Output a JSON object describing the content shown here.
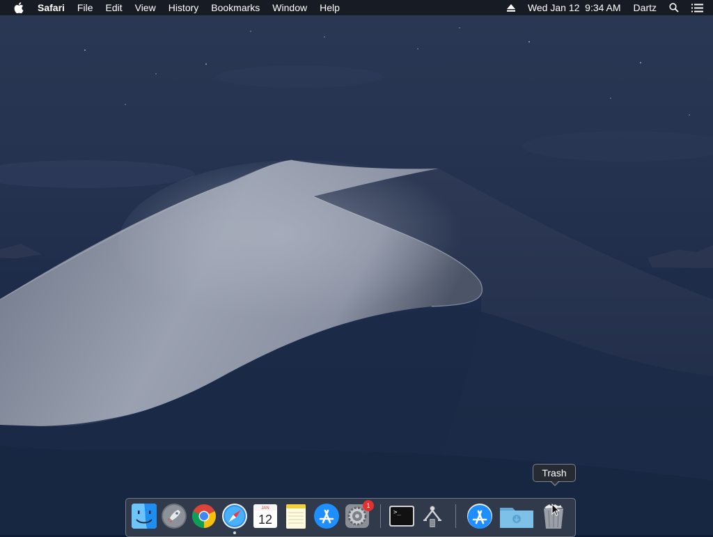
{
  "menubar": {
    "apple_icon": "apple-logo-icon",
    "app_name": "Safari",
    "menus": [
      "File",
      "Edit",
      "View",
      "History",
      "Bookmarks",
      "Window",
      "Help"
    ],
    "status": {
      "eject_icon": "eject-icon",
      "datetime": "Wed Jan 12  9:34 AM",
      "user": "Dartz",
      "search_icon": "spotlight-search-icon",
      "notification_icon": "notification-center-icon"
    }
  },
  "tooltip": {
    "text": "Trash"
  },
  "dock": {
    "items": [
      {
        "name": "Finder",
        "icon": "finder-icon"
      },
      {
        "name": "Launchpad",
        "icon": "launchpad-icon"
      },
      {
        "name": "Google Chrome",
        "icon": "chrome-icon"
      },
      {
        "name": "Safari",
        "icon": "safari-icon",
        "running": true
      },
      {
        "name": "Calendar",
        "icon": "calendar-icon",
        "month": "JAN",
        "day": "12"
      },
      {
        "name": "Notes",
        "icon": "notes-icon"
      },
      {
        "name": "App Store",
        "icon": "app-store-icon"
      },
      {
        "name": "System Preferences",
        "icon": "system-preferences-icon",
        "badge": "1"
      },
      {
        "name": "Terminal",
        "icon": "terminal-icon",
        "glyph": ">_"
      },
      {
        "name": "Automator",
        "icon": "automator-icon"
      },
      {
        "name": "App Store Download",
        "icon": "app-store-download-icon"
      },
      {
        "name": "Downloads",
        "icon": "downloads-folder-icon"
      },
      {
        "name": "Trash",
        "icon": "trash-icon"
      }
    ]
  },
  "colors": {
    "menubar_bg": "#16191f",
    "sky_top": "#26334f",
    "dune_light": "#8e95a5",
    "badge_red": "#e5302d",
    "appstore_blue": "#1f8fff"
  }
}
